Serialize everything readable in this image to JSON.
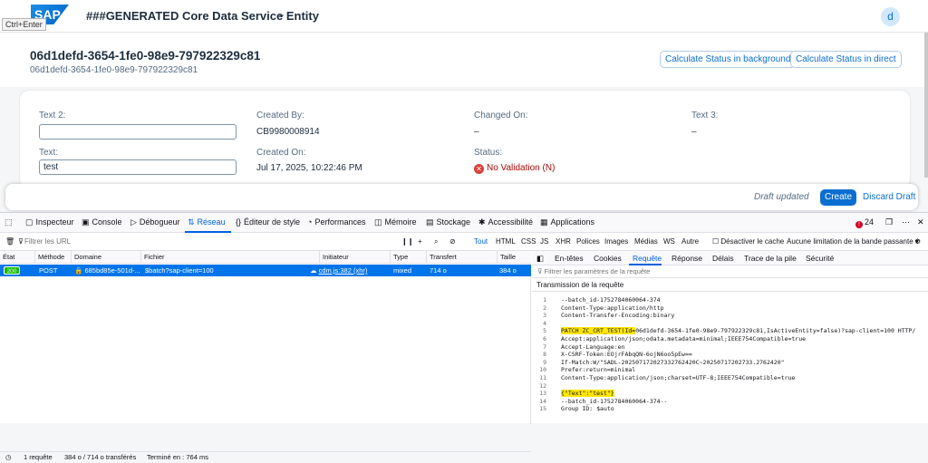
{
  "shell": {
    "logo": "SAP",
    "shortcut_tip": "Ctrl+Enter",
    "title": "###GENERATED Core Data Service Entity",
    "avatar_initial": "d"
  },
  "object": {
    "title": "06d1defd-3654-1fe0-98e9-797922329c81",
    "subtitle": "06d1defd-3654-1fe0-98e9-797922329c81",
    "btn_background": "Calculate Status in background",
    "btn_direct": "Calculate Status in direct"
  },
  "form": {
    "text2_label": "Text 2:",
    "text2_value": "",
    "created_by_label": "Created By:",
    "created_by_value": "CB9980008914",
    "changed_on_label": "Changed On:",
    "changed_on_value": "–",
    "text3_label": "Text 3:",
    "text3_value": "–",
    "text_label": "Text:",
    "text_value": "test",
    "created_on_label": "Created On:",
    "created_on_value": "Jul 17, 2025, 10:22:46 PM",
    "status_label": "Status:",
    "status_value": "No Validation (N)"
  },
  "footer": {
    "draft_status": "Draft updated",
    "create": "Create",
    "discard": "Discard Draft"
  },
  "devtools": {
    "tabs": [
      "Inspecteur",
      "Console",
      "Débogueur",
      "Réseau",
      "Éditeur de style",
      "Performances",
      "Mémoire",
      "Stockage",
      "Accessibilité",
      "Applications"
    ],
    "error_count": "24",
    "filter_url": "Filtrer les URL",
    "type_filters": [
      "Tout",
      "HTML",
      "CSS",
      "JS",
      "XHR",
      "Polices",
      "Images",
      "Médias",
      "WS",
      "Autre"
    ],
    "disable_cache": "Désactiver le cache",
    "throttle": "Aucune limitation de la bande passante",
    "columns": [
      "État",
      "Méthode",
      "Domaine",
      "Fichier",
      "Initiateur",
      "Type",
      "Transfert",
      "Taille"
    ],
    "row": {
      "status": "200",
      "method": "POST",
      "domain": "685bd85e-501d-...",
      "file": "$batch?sap-client=100",
      "initiator": "cdm.js:382 (xhr)",
      "type": "mixed",
      "transfer": "714 o",
      "size": "384 o"
    },
    "summary": {
      "requests": "1 requête",
      "transferred": "384 o / 714 o transférés",
      "finished": "Terminé en : 764 ms"
    },
    "detail_tabs": [
      "En-têtes",
      "Cookies",
      "Requête",
      "Réponse",
      "Délais",
      "Trace de la pile",
      "Sécurité"
    ],
    "param_filter": "Filtrer les paramètres de la requête",
    "request_transmission": "Transmission de la requête",
    "code_lines": [
      "--batch_id-1752784060064-374",
      "Content-Type:application/http",
      "Content-Transfer-Encoding:binary",
      "",
      "PATCH ZC_CRT_TEST(Id=06d1defd-3654-1fe0-98e9-797922329c81,IsActiveEntity=false)?sap-client=100 HTTP/",
      "Accept:application/json;odata.metadata=minimal;IEEE754Compatible=true",
      "Accept-Language:en",
      "X-CSRF-Token:EOjrFAbqQN-6ojN6oo5pEw==",
      "If-Match:W/\"SADL-202507172027332762420C~20250717202733.2762420\"",
      "Prefer:return=minimal",
      "Content-Type:application/json;charset=UTF-8;IEEE754Compatible=true",
      "",
      "{\"Text\":\"test\"}",
      "--batch_id-1752784060064-374--",
      "Group ID: $auto"
    ]
  }
}
